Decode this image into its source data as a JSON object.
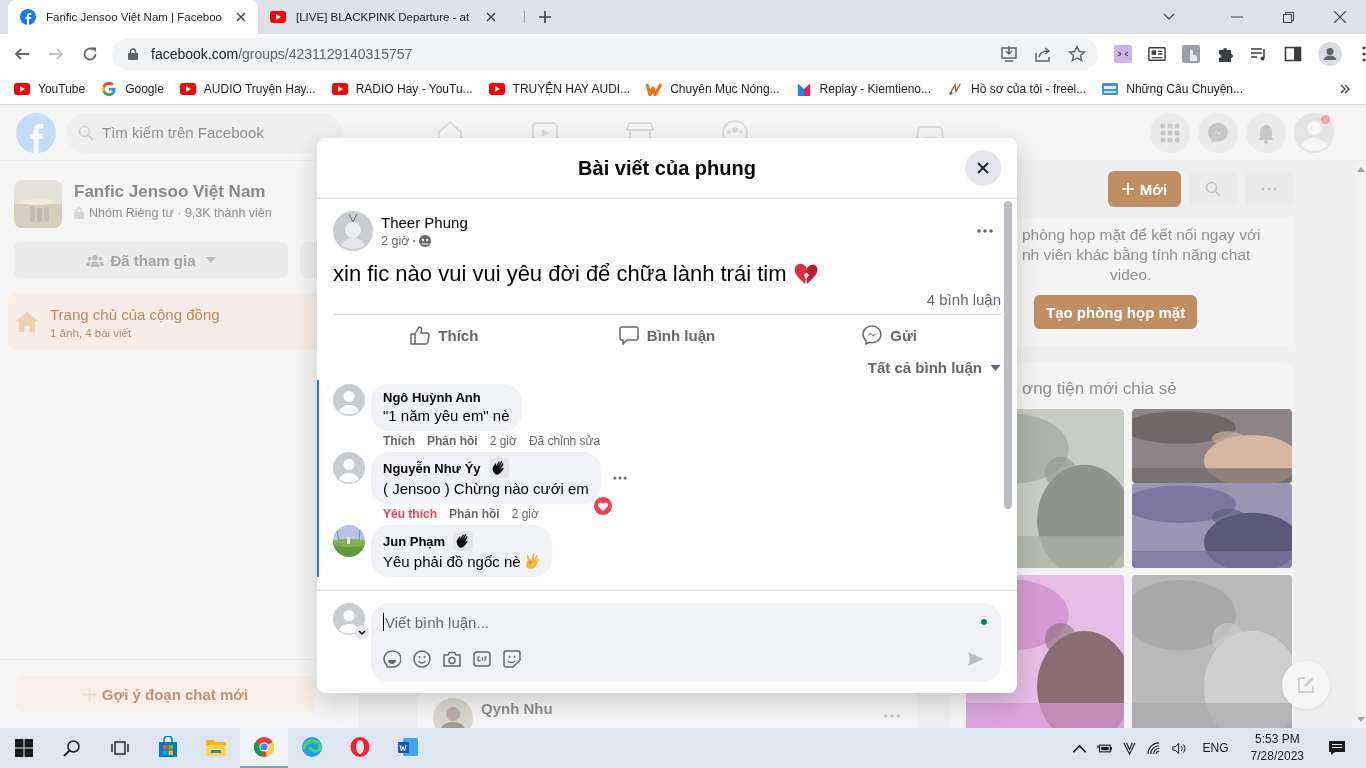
{
  "browser": {
    "tabs": [
      {
        "title": "Fanfic Jensoo Việt Nam | Faceboo",
        "kind": "facebook",
        "selected": true
      },
      {
        "title": "[LIVE] BLACKPINK Departure - at",
        "kind": "youtube",
        "selected": false
      }
    ],
    "address": {
      "host": "facebook.com",
      "path": "/groups/4231129140315757"
    },
    "bookmarks": [
      {
        "label": "YouTube",
        "kind": "youtube"
      },
      {
        "label": "Google",
        "kind": "google"
      },
      {
        "label": "AUDIO Truyện Hay...",
        "kind": "youtube"
      },
      {
        "label": "RADIO Hay - YouTu...",
        "kind": "youtube"
      },
      {
        "label": "TRUYỆN HAY AUDI...",
        "kind": "youtube"
      },
      {
        "label": "Chuyên Mục Nóng...",
        "kind": "wattpad"
      },
      {
        "label": "Replay - Kiemtieno...",
        "kind": "bookmark"
      },
      {
        "label": "Hồ sơ của tôi - freel...",
        "kind": "quill"
      },
      {
        "label": "Những Câu Chuyện...",
        "kind": "site"
      }
    ]
  },
  "facebook": {
    "search_placeholder": "Tìm kiếm trên Facebook",
    "has_notification": true,
    "group": {
      "name": "Fanfic Jensoo Việt Nam",
      "meta": "Nhóm Riêng tư · 9,3K thành viên",
      "joined_label": "Đã tham gia"
    },
    "community": {
      "title": "Trang chủ của cộng đồng",
      "subtitle": "1 ảnh, 4 bài viết",
      "selected": true
    },
    "new_chat_label": "Gợi ý đoạn chat mới",
    "chat_panel": {
      "new_label": "Mới",
      "room_text": [
        "phòng họp mặt để kết nối ngay với",
        "nh viên khác bằng tính năng chat",
        "video."
      ],
      "room_button": "Tạo phòng họp mặt"
    },
    "media": {
      "title": "ơng tiện mới chia sẻ"
    },
    "feed_post": {
      "author": "Qynh Nhu"
    }
  },
  "modal": {
    "title": "Bài viết của phung",
    "post": {
      "author": "Theer Phung",
      "time": "2 giờ",
      "text": "xin fic nào vui vui yêu đời để chữa lành trái tim",
      "with_emoji": true,
      "comment_count": "4 bình luận"
    },
    "actions": [
      {
        "label": "Thích",
        "kind": "like"
      },
      {
        "label": "Bình luận",
        "kind": "comment"
      },
      {
        "label": "Gửi",
        "kind": "messenger"
      }
    ],
    "sort_label": "Tất cả bình luận",
    "comments": [
      {
        "author": "Ngô Huỳnh Anh",
        "text": "\"1 năm yêu em\" nè",
        "with_emoji": false,
        "has_photo": false,
        "fan_badge": false,
        "hovered": false,
        "loved": false,
        "like_label": "Thích",
        "reply_label": "Phản hồi",
        "time": "2 giờ",
        "edited_label": "Đã chỉnh sửa"
      },
      {
        "author": "Nguyễn Như Ýy",
        "text": "( Jensoo ) Chừng nào cưới em",
        "with_emoji": false,
        "has_photo": false,
        "fan_badge": true,
        "hovered": true,
        "loved": true,
        "like_label": "Yêu thích",
        "reply_label": "Phản hồi",
        "time": "2 giờ"
      },
      {
        "author": "Jun Phạm",
        "text": "Yêu phải đồ ngốc nè",
        "with_emoji": true,
        "has_photo": true,
        "fan_badge": true,
        "hovered": false,
        "loved": false
      }
    ],
    "composer": {
      "placeholder": "Viết bình luận...",
      "online": true
    }
  },
  "taskbar": {
    "apps": [
      {
        "kind": "store",
        "active": false
      },
      {
        "kind": "files",
        "active": false
      },
      {
        "kind": "chrome",
        "active": true
      },
      {
        "kind": "edge",
        "active": false
      },
      {
        "kind": "opera",
        "active": false
      },
      {
        "kind": "word",
        "active": false
      }
    ],
    "language": "ENG",
    "time": "5:53 PM",
    "date": "7/28/2023"
  }
}
